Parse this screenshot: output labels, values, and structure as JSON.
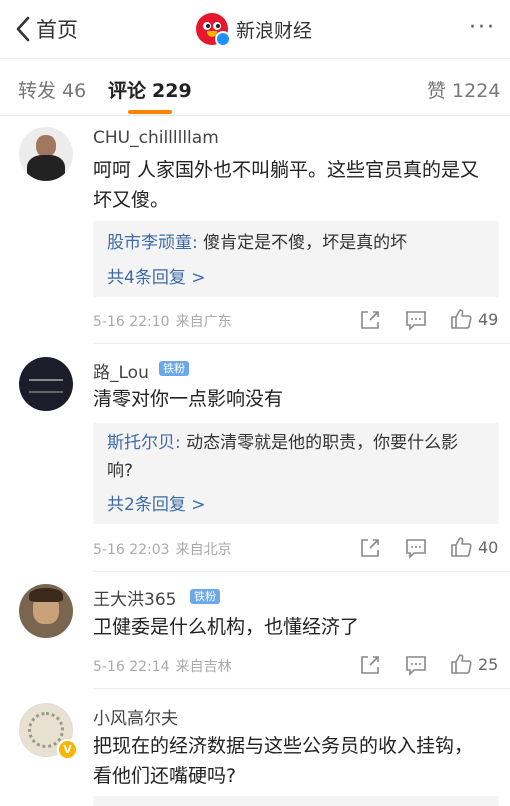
{
  "header": {
    "back_label": "首页",
    "title": "新浪财经",
    "more": "···"
  },
  "tabs": {
    "repost_label": "转发",
    "repost_count": "46",
    "comment_label": "评论",
    "comment_count": "229",
    "like_label": "赞",
    "like_count": "1224"
  },
  "comments": [
    {
      "user": "CHU_chillllllam",
      "text": "呵呵 人家国外也不叫躺平。这些官员真的是又坏又傻。",
      "reply_user": "股市李顽童:",
      "reply_text": " 傻肯定是不傻，坏是真的坏",
      "more_replies": "共4条回复 >",
      "date": "5-16 22:10",
      "location": "来自广东",
      "likes": "49"
    },
    {
      "user": "路_Lou",
      "badge": "铁粉",
      "text": "清零对你一点影响没有",
      "reply_user": "斯托尔贝:",
      "reply_text": " 动态清零就是他的职责，你要什么影响?",
      "more_replies": "共2条回复 >",
      "date": "5-16 22:03",
      "location": "来自北京",
      "likes": "40"
    },
    {
      "user": "王大洪365",
      "badge": "铁粉",
      "text": "卫健委是什么机构，也懂经济了",
      "date": "5-16 22:14",
      "location": "来自吉林",
      "likes": "25"
    },
    {
      "user": "小风高尔夫",
      "verified_mark": "V",
      "text": "把现在的经济数据与这些公务员的收入挂钩，看他们还嘴硬吗?"
    }
  ],
  "colors": {
    "accent": "#ff8200",
    "link": "#3c6ba8",
    "brand": "#e6162d"
  },
  "icons": [
    "chevron-left-icon",
    "sina-weibo-logo",
    "more-dots-icon",
    "share-icon",
    "comment-icon",
    "thumbs-up-icon"
  ]
}
